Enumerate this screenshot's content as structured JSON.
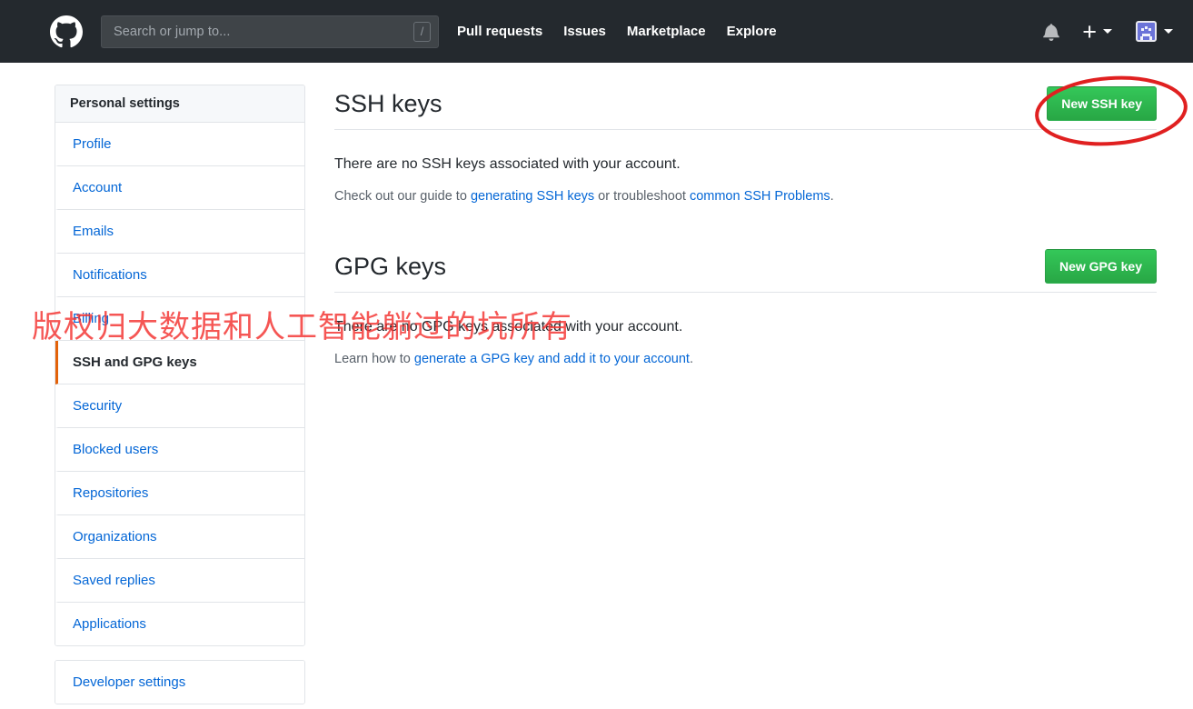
{
  "header": {
    "logo_icon": "github-mark-icon",
    "search": {
      "placeholder": "Search or jump to...",
      "value": "",
      "shortcut_badge": "/"
    },
    "nav": [
      {
        "label": "Pull requests",
        "name": "nav-pull-requests"
      },
      {
        "label": "Issues",
        "name": "nav-issues"
      },
      {
        "label": "Marketplace",
        "name": "nav-marketplace"
      },
      {
        "label": "Explore",
        "name": "nav-explore"
      }
    ],
    "notifications_icon": "bell-icon",
    "create_new_icon": "plus-icon",
    "create_new_caret_icon": "chevron-down-icon",
    "avatar_icon": "user-avatar-identicon",
    "avatar_caret_icon": "chevron-down-icon"
  },
  "sidebar": {
    "heading": "Personal settings",
    "items": [
      {
        "label": "Profile",
        "name": "sidebar-item-profile",
        "selected": false
      },
      {
        "label": "Account",
        "name": "sidebar-item-account",
        "selected": false
      },
      {
        "label": "Emails",
        "name": "sidebar-item-emails",
        "selected": false
      },
      {
        "label": "Notifications",
        "name": "sidebar-item-notifications",
        "selected": false
      },
      {
        "label": "Billing",
        "name": "sidebar-item-billing",
        "selected": false
      },
      {
        "label": "SSH and GPG keys",
        "name": "sidebar-item-ssh-and-gpg-keys",
        "selected": true
      },
      {
        "label": "Security",
        "name": "sidebar-item-security",
        "selected": false
      },
      {
        "label": "Blocked users",
        "name": "sidebar-item-blocked-users",
        "selected": false
      },
      {
        "label": "Repositories",
        "name": "sidebar-item-repositories",
        "selected": false
      },
      {
        "label": "Organizations",
        "name": "sidebar-item-organizations",
        "selected": false
      },
      {
        "label": "Saved replies",
        "name": "sidebar-item-saved-replies",
        "selected": false
      },
      {
        "label": "Applications",
        "name": "sidebar-item-applications",
        "selected": false
      }
    ],
    "developer_settings": "Developer settings"
  },
  "ssh_section": {
    "title": "SSH keys",
    "new_button": "New SSH key",
    "empty_message": "There are no SSH keys associated with your account.",
    "help_prefix": "Check out our guide to ",
    "help_link_1": "generating SSH keys",
    "help_middle": " or troubleshoot ",
    "help_link_2": "common SSH Problems",
    "help_suffix": "."
  },
  "gpg_section": {
    "title": "GPG keys",
    "new_button": "New GPG key",
    "empty_message": "There are no GPG keys associated with your account.",
    "help_prefix": "Learn how to ",
    "help_link_1": "generate a GPG key and add it to your account",
    "help_suffix": "."
  },
  "annotations": {
    "highlight_ellipse_target": "New SSH key",
    "watermark_text": "版权归大数据和人工智能躺过的坑所有"
  },
  "colors": {
    "header_bg": "#24292e",
    "link_blue": "#0366d6",
    "button_green": "#28a745",
    "selected_accent": "#e36209",
    "annotation_red": "#e02020"
  }
}
